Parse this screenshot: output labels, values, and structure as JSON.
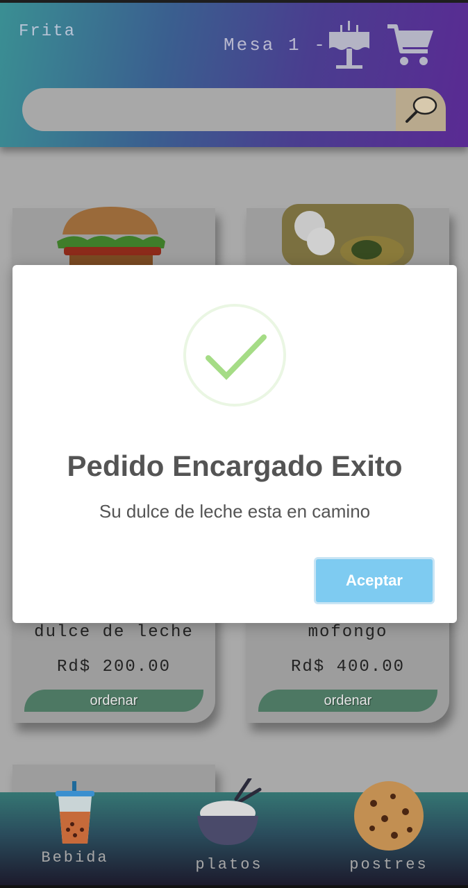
{
  "header": {
    "restaurant": "Frita",
    "table_label": "Mesa 1 -"
  },
  "search": {
    "placeholder": ""
  },
  "products": [
    {
      "name": "dulce de leche",
      "price": "Rd$ 200.00",
      "order_label": "ordenar"
    },
    {
      "name": "mofongo",
      "price": "Rd$ 400.00",
      "order_label": "ordenar"
    }
  ],
  "nav": {
    "items": [
      {
        "label": "Bebida"
      },
      {
        "label": "platos"
      },
      {
        "label": "postres"
      }
    ]
  },
  "modal": {
    "title": "Pedido Encargado Exito",
    "text": "Su dulce de leche esta en camino",
    "accept_label": "Aceptar"
  },
  "colors": {
    "accept_button": "#7ecbf1",
    "success_check": "#a5dc86",
    "order_button": "#4d7863"
  },
  "icons": [
    "table-icon",
    "cart-icon",
    "search-icon",
    "success-check-icon",
    "drink-icon",
    "rice-bowl-icon",
    "cookie-icon"
  ]
}
